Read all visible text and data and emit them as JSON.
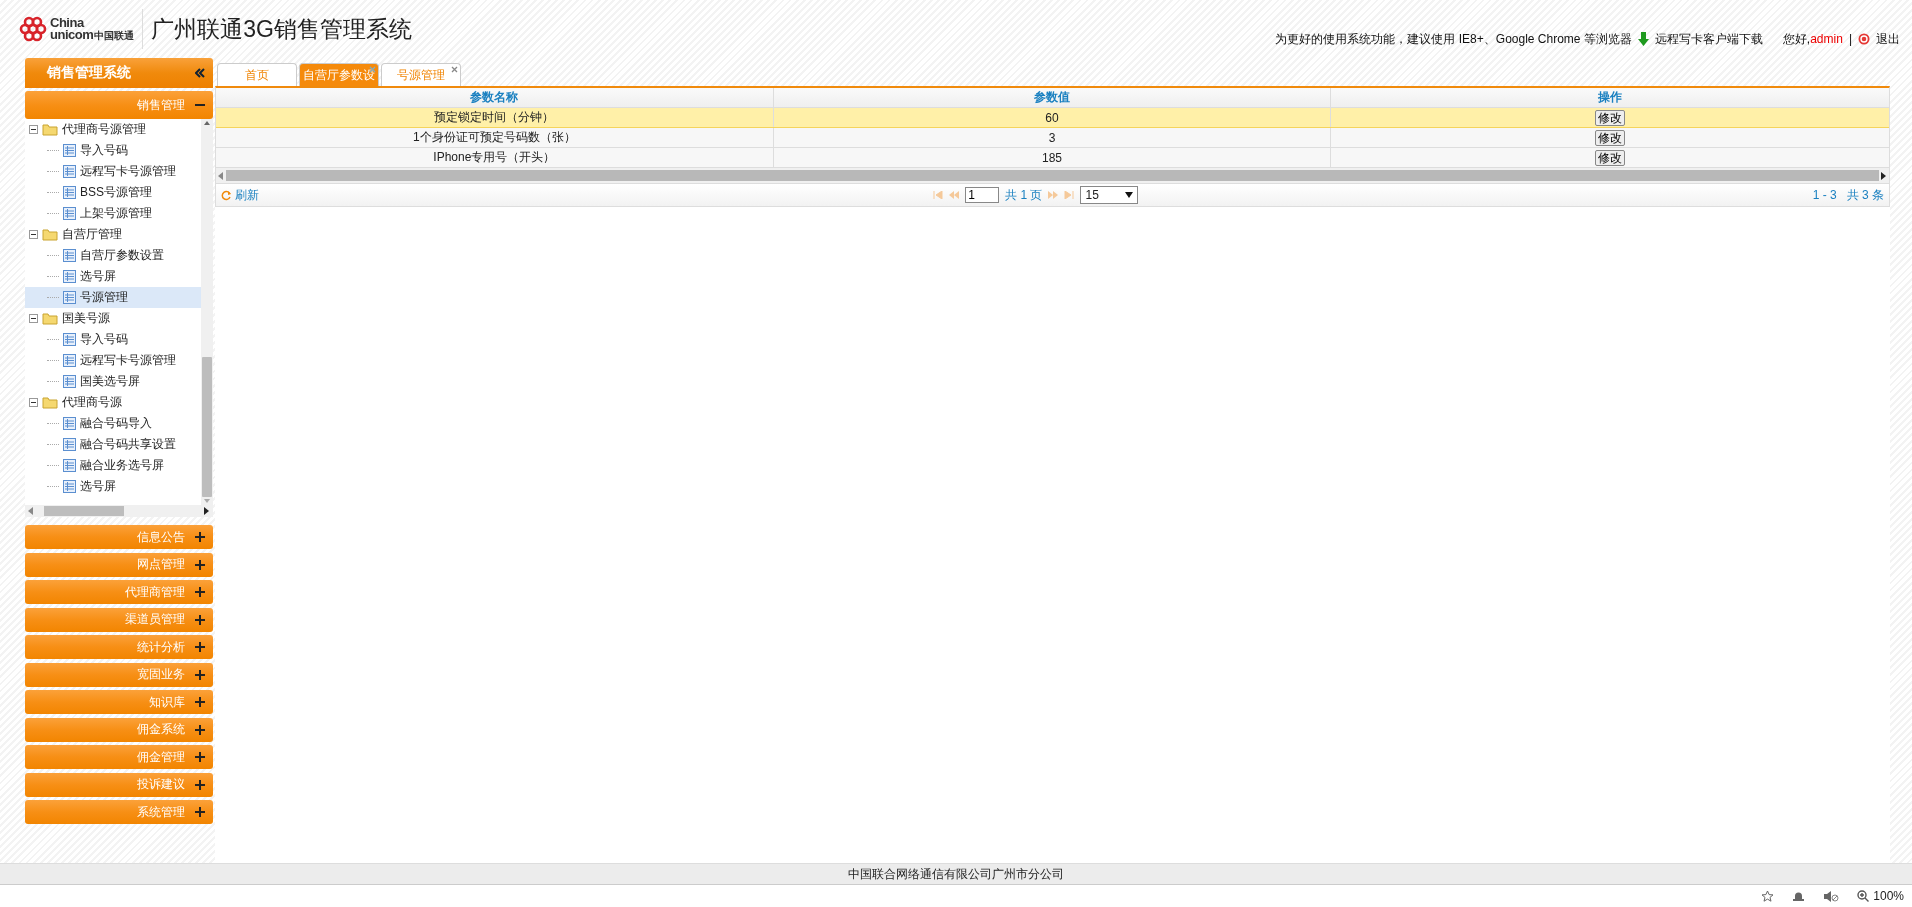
{
  "header": {
    "logo_lines": [
      "China",
      "unicom",
      "中国联通"
    ],
    "title": "广州联通3G销售管理系统",
    "notice": "为更好的使用系统功能，建议使用 IE8+、Google Chrome 等浏览器",
    "download": "远程写卡客户端下载",
    "greeting": "您好,",
    "user": "admin",
    "separator": "|",
    "logout": "退出"
  },
  "sidebar": {
    "title": "销售管理系统",
    "sections": [
      {
        "label": "销售管理",
        "expanded": true,
        "tree": [
          {
            "label": "代理商号源管理",
            "expanded": true,
            "children": [
              {
                "label": "导入号码",
                "selected": false
              },
              {
                "label": "远程写卡号源管理",
                "selected": false
              },
              {
                "label": "BSS号源管理",
                "selected": false
              },
              {
                "label": "上架号源管理",
                "selected": false
              }
            ]
          },
          {
            "label": "自营厅管理",
            "expanded": true,
            "children": [
              {
                "label": "自营厅参数设置",
                "selected": false
              },
              {
                "label": "选号屏",
                "selected": false
              },
              {
                "label": "号源管理",
                "selected": true
              }
            ]
          },
          {
            "label": "国美号源",
            "expanded": true,
            "children": [
              {
                "label": "导入号码",
                "selected": false
              },
              {
                "label": "远程写卡号源管理",
                "selected": false
              },
              {
                "label": "国美选号屏",
                "selected": false
              }
            ]
          },
          {
            "label": "代理商号源",
            "expanded": true,
            "children": [
              {
                "label": "融合号码导入",
                "selected": false
              },
              {
                "label": "融合号码共享设置",
                "selected": false
              },
              {
                "label": "融合业务选号屏",
                "selected": false
              },
              {
                "label": "选号屏",
                "selected": false
              }
            ]
          }
        ]
      },
      {
        "label": "信息公告",
        "expanded": false
      },
      {
        "label": "网点管理",
        "expanded": false
      },
      {
        "label": "代理商管理",
        "expanded": false
      },
      {
        "label": "渠道员管理",
        "expanded": false
      },
      {
        "label": "统计分析",
        "expanded": false
      },
      {
        "label": "宽固业务",
        "expanded": false
      },
      {
        "label": "知识库",
        "expanded": false
      },
      {
        "label": "佣金系统",
        "expanded": false
      },
      {
        "label": "佣金管理",
        "expanded": false
      },
      {
        "label": "投诉建议",
        "expanded": false
      },
      {
        "label": "系统管理",
        "expanded": false
      }
    ]
  },
  "tabs": [
    {
      "label": "首页",
      "selected": false,
      "closable": false
    },
    {
      "label": "自营厅参数设",
      "selected": true,
      "closable": true
    },
    {
      "label": "号源管理",
      "selected": false,
      "closable": true
    }
  ],
  "table": {
    "columns": [
      "参数名称",
      "参数值",
      "操作"
    ],
    "rows": [
      {
        "cells": [
          "预定锁定时间（分钟）",
          "60"
        ],
        "action": "修改",
        "selected": true
      },
      {
        "cells": [
          "1个身份证可预定号码数（张）",
          "3"
        ],
        "action": "修改",
        "selected": false
      },
      {
        "cells": [
          "IPhone专用号（开头）",
          "185"
        ],
        "action": "修改",
        "selected": false
      }
    ]
  },
  "pager": {
    "refresh": "刷新",
    "page": "1",
    "total_pages": "共 1 页",
    "page_size": "15",
    "summary": "1 - 3   共 3 条"
  },
  "footer": "中国联合网络通信有限公司广州市分公司",
  "status_bar": {
    "zoom": "100%"
  }
}
